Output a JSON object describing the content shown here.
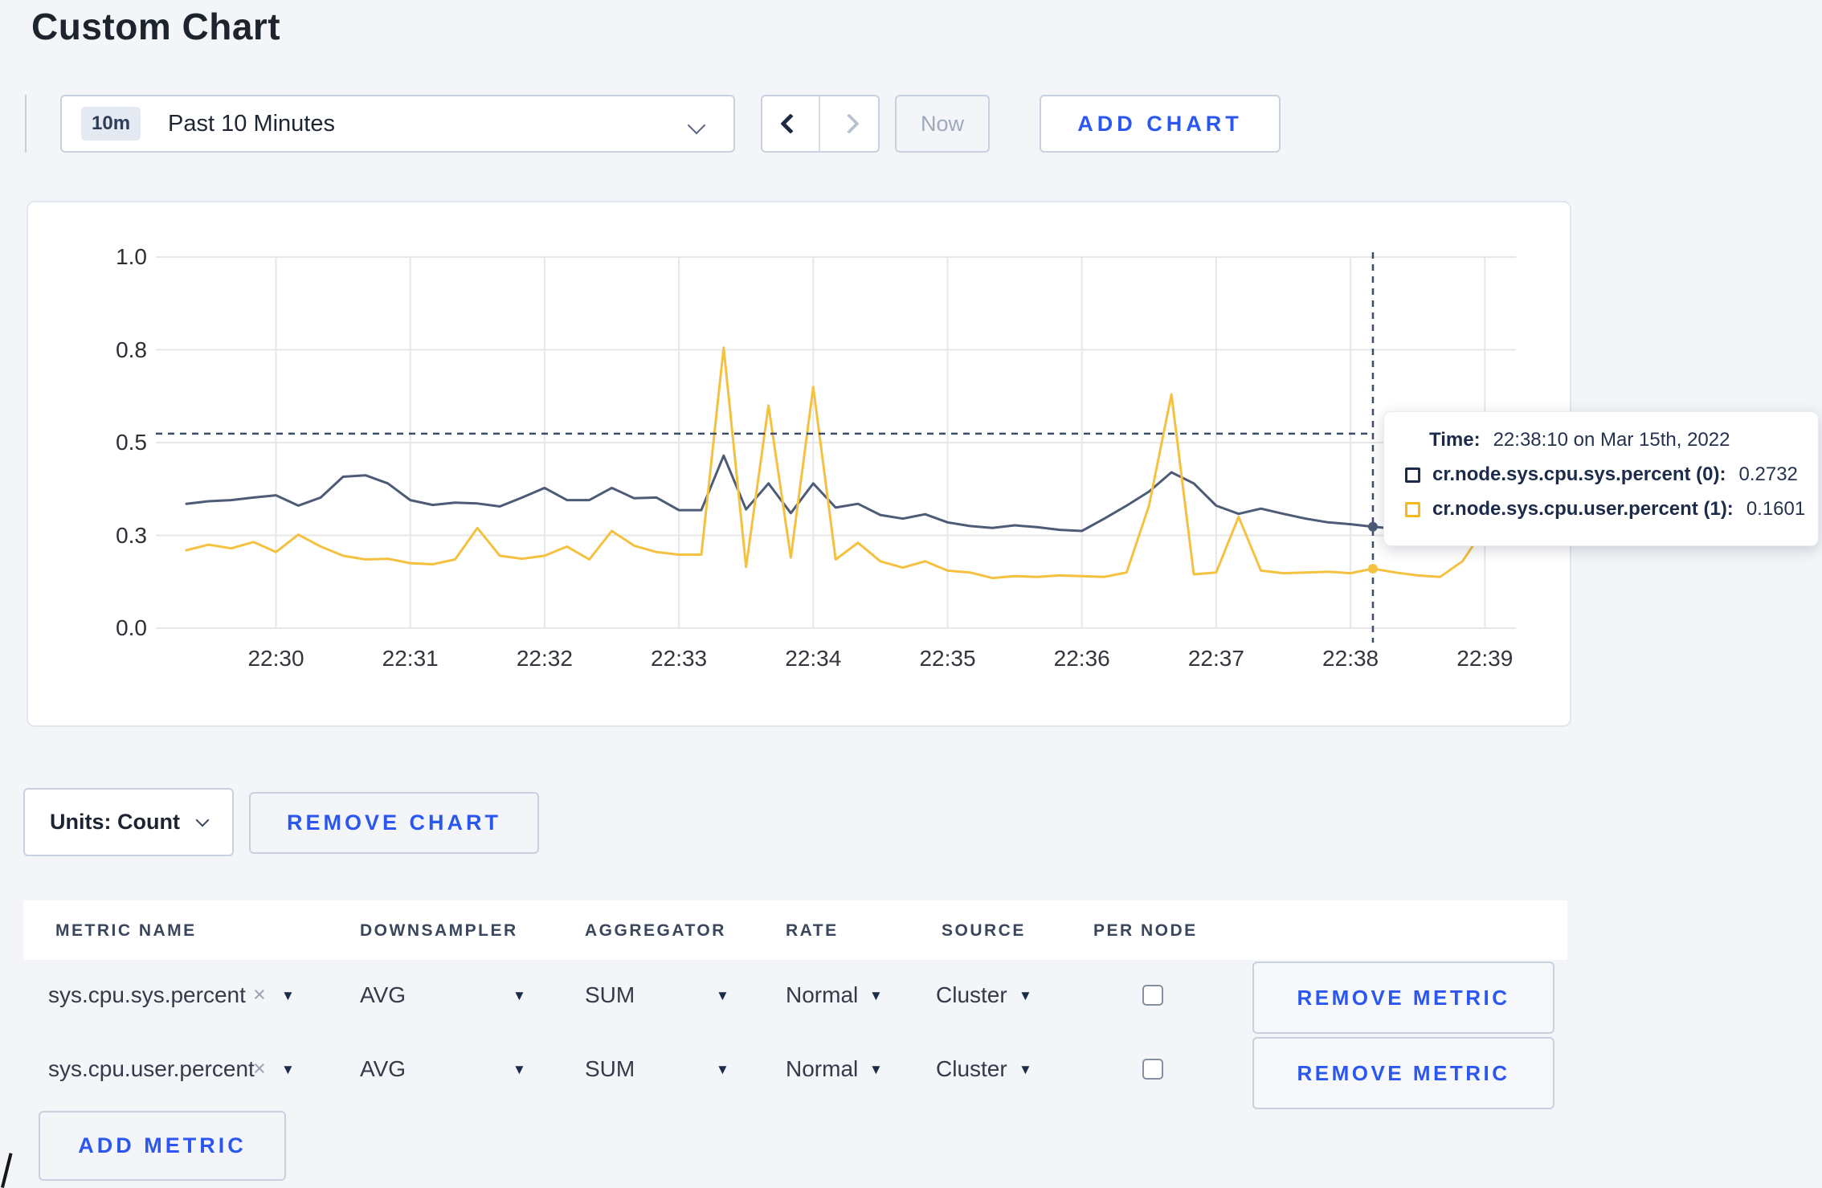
{
  "page": {
    "title": "Custom Chart"
  },
  "toolbar": {
    "time_range_badge": "10m",
    "time_range_label": "Past 10 Minutes",
    "now_label": "Now",
    "add_chart_label": "ADD CHART"
  },
  "chart_data": {
    "type": "line",
    "title": "",
    "xlabel": "",
    "ylabel": "",
    "ylim": [
      0,
      1
    ],
    "y_ticks": [
      {
        "label": "1.0",
        "value": 1.0
      },
      {
        "label": "0.8",
        "value": 0.75
      },
      {
        "label": "0.5",
        "value": 0.5
      },
      {
        "label": "0.3",
        "value": 0.25
      },
      {
        "label": "0.0",
        "value": 0.0
      }
    ],
    "x_ticks": [
      "22:30",
      "22:31",
      "22:32",
      "22:33",
      "22:34",
      "22:35",
      "22:36",
      "22:37",
      "22:38",
      "22:39"
    ],
    "x_start": "22:29:20",
    "x_step_seconds": 10,
    "grid": true,
    "series": [
      {
        "name": "cr.node.sys.cpu.sys.percent (0)",
        "color": "#4e5b77",
        "values": [
          0.335,
          0.342,
          0.345,
          0.352,
          0.358,
          0.33,
          0.352,
          0.408,
          0.412,
          0.39,
          0.345,
          0.332,
          0.338,
          0.336,
          0.328,
          0.352,
          0.378,
          0.345,
          0.345,
          0.378,
          0.35,
          0.352,
          0.318,
          0.318,
          0.465,
          0.32,
          0.39,
          0.31,
          0.39,
          0.325,
          0.335,
          0.305,
          0.295,
          0.307,
          0.285,
          0.275,
          0.27,
          0.277,
          0.272,
          0.265,
          0.262,
          0.295,
          0.33,
          0.368,
          0.42,
          0.39,
          0.33,
          0.308,
          0.322,
          0.308,
          0.295,
          0.285,
          0.28,
          0.2732,
          0.268,
          0.275,
          0.27,
          0.287,
          0.3,
          0.282
        ]
      },
      {
        "name": "cr.node.sys.cpu.user.percent (1)",
        "color": "#f4c141",
        "values": [
          0.21,
          0.225,
          0.215,
          0.232,
          0.205,
          0.252,
          0.22,
          0.195,
          0.185,
          0.187,
          0.175,
          0.172,
          0.185,
          0.27,
          0.195,
          0.187,
          0.195,
          0.22,
          0.185,
          0.262,
          0.222,
          0.205,
          0.198,
          0.198,
          0.756,
          0.165,
          0.6,
          0.19,
          0.65,
          0.185,
          0.23,
          0.18,
          0.163,
          0.18,
          0.155,
          0.15,
          0.135,
          0.14,
          0.138,
          0.142,
          0.14,
          0.138,
          0.15,
          0.33,
          0.63,
          0.145,
          0.15,
          0.3,
          0.155,
          0.148,
          0.15,
          0.152,
          0.148,
          0.1601,
          0.15,
          0.142,
          0.138,
          0.18,
          0.27,
          0.23
        ]
      }
    ],
    "crosshair": {
      "index": 53,
      "time": "22:38:10",
      "h_line_value": 0.524
    },
    "legend_position": "tooltip"
  },
  "tooltip": {
    "time_label": "Time:",
    "time_value": "22:38:10 on Mar 15th, 2022",
    "series": [
      {
        "label": "cr.node.sys.cpu.sys.percent (0):",
        "value": "0.2732",
        "color": "#1c2b4a"
      },
      {
        "label": "cr.node.sys.cpu.user.percent (1):",
        "value": "0.1601",
        "color": "#f5b818"
      }
    ]
  },
  "chart_controls": {
    "units_label": "Units: Count",
    "remove_chart_label": "REMOVE CHART"
  },
  "metrics_table": {
    "headers": [
      "METRIC NAME",
      "DOWNSAMPLER",
      "AGGREGATOR",
      "RATE",
      "SOURCE",
      "PER NODE"
    ],
    "rows": [
      {
        "metric": "sys.cpu.sys.percent",
        "remove_symbol": "×",
        "downsampler": "AVG",
        "aggregator": "SUM",
        "rate": "Normal",
        "source": "Cluster",
        "per_node_checked": false,
        "remove_label": "REMOVE METRIC"
      },
      {
        "metric": "sys.cpu.user.percent",
        "remove_symbol": "×",
        "downsampler": "AVG",
        "aggregator": "SUM",
        "rate": "Normal",
        "source": "Cluster",
        "per_node_checked": false,
        "remove_label": "REMOVE METRIC"
      }
    ],
    "add_metric_label": "ADD METRIC"
  }
}
